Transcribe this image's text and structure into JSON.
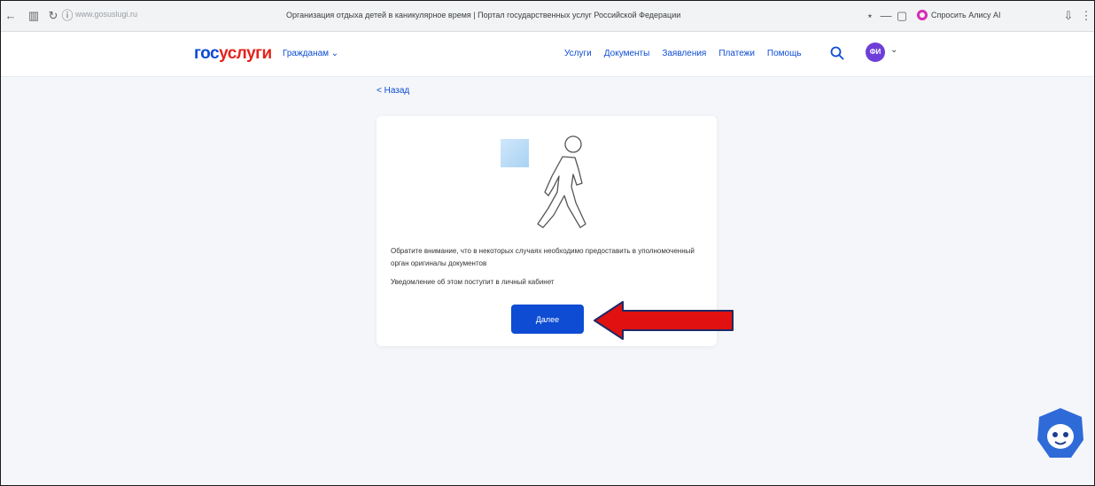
{
  "browser": {
    "url": "www.gosuslugi.ru",
    "tab_title": "Организация отдыха детей в каникулярное время | Портал государственных услуг Российской Федерации",
    "alice_label": "Спросить Алису AI"
  },
  "header": {
    "logo_part1": "гос",
    "logo_part2": "услуги",
    "role": "Гражданам ⌄",
    "nav": [
      "Услуги",
      "Документы",
      "Заявления",
      "Платежи",
      "Помощь"
    ],
    "avatar_initials": "ФИ"
  },
  "content": {
    "back_link": "< Назад",
    "paragraph1": "Обратите внимание, что в некоторых случаях необходимо предоставить в уполномоченный орган оригиналы документов",
    "paragraph2": "Уведомление об этом поступит в личный кабинет",
    "next_button": "Далее"
  },
  "colors": {
    "brand_blue": "#0d4cd3",
    "brand_red": "#e3241d",
    "arrow_red": "#e11111",
    "avatar": "#6e3fd8"
  }
}
